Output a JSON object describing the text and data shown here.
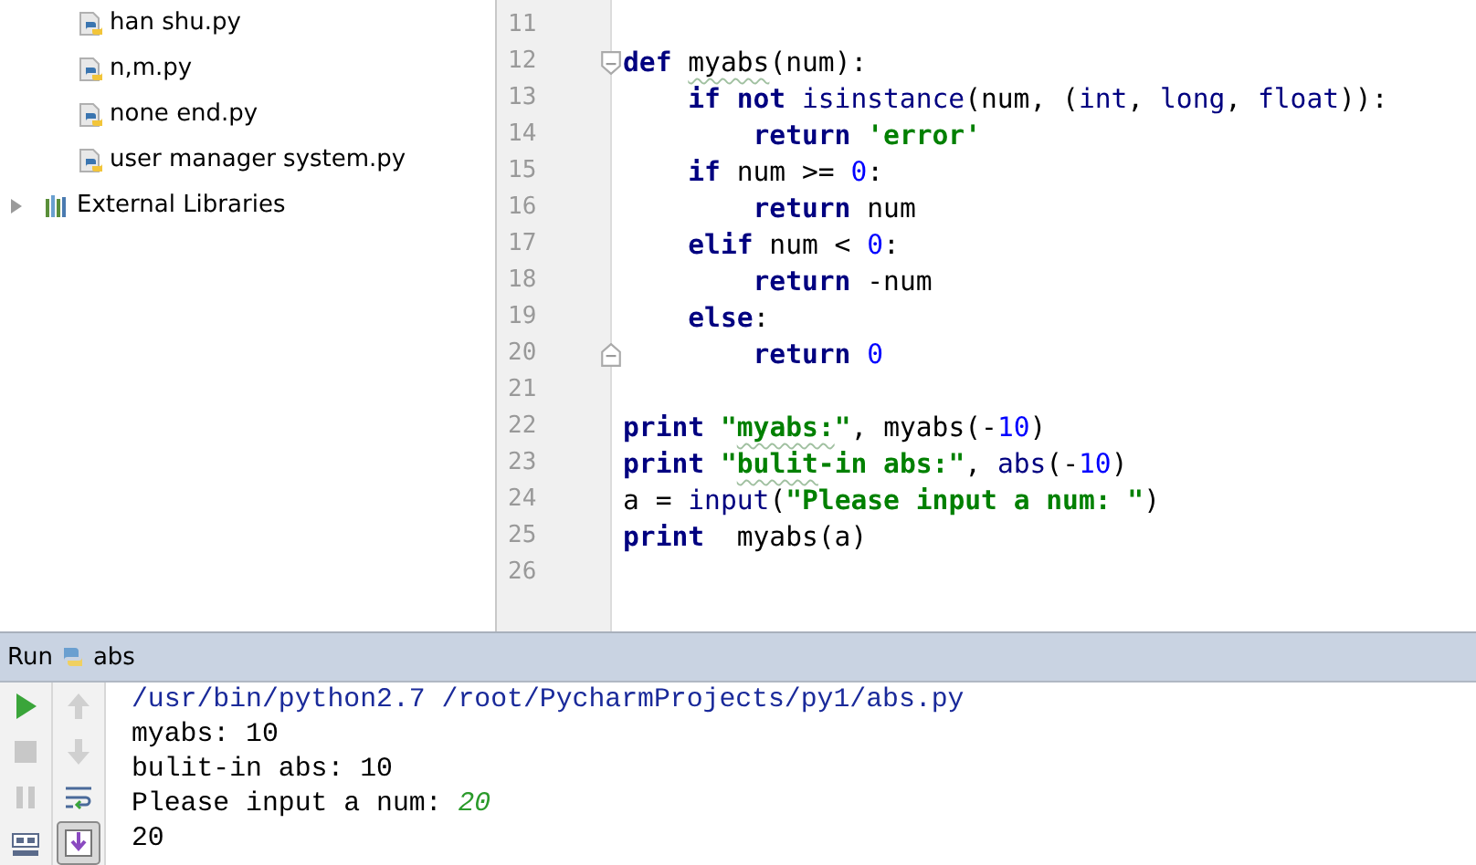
{
  "project_tree": {
    "files": [
      {
        "name": "han shu.py"
      },
      {
        "name": "n,m.py"
      },
      {
        "name": "none end.py"
      },
      {
        "name": "user manager system.py"
      }
    ],
    "libraries": {
      "name": "External Libraries",
      "expanded": false
    }
  },
  "editor": {
    "lines": [
      {
        "number": "11"
      },
      {
        "number": "12",
        "fold_start": true,
        "tokens": [
          {
            "t": "def ",
            "kind": "keyword"
          },
          {
            "t": "myabs",
            "warn": true
          },
          {
            "t": "(num):"
          }
        ],
        "children": [
          {
            "number": "13",
            "tokens": [
              {
                "t": "if not ",
                "kind": "keyword"
              },
              {
                "t": "isinstance",
                "kind": "builtin"
              },
              {
                "t": "(num, ("
              },
              {
                "t": "int",
                "kind": "builtin"
              },
              {
                "t": ", "
              },
              {
                "t": "long",
                "kind": "builtin"
              },
              {
                "t": ", "
              },
              {
                "t": "float",
                "kind": "builtin"
              },
              {
                "t": ")):"
              }
            ],
            "children": [
              {
                "number": "14",
                "tokens": [
                  {
                    "t": "return ",
                    "kind": "keyword"
                  },
                  {
                    "t": "'error'",
                    "kind": "string"
                  }
                ]
              }
            ]
          },
          {
            "number": "15",
            "tokens": [
              {
                "t": "if ",
                "kind": "keyword"
              },
              {
                "t": "num >= "
              },
              {
                "t": "0",
                "kind": "number"
              },
              {
                "t": ":"
              }
            ],
            "children": [
              {
                "number": "16",
                "tokens": [
                  {
                    "t": "return ",
                    "kind": "keyword"
                  },
                  {
                    "t": "num"
                  }
                ]
              }
            ]
          },
          {
            "number": "17",
            "tokens": [
              {
                "t": "elif ",
                "kind": "keyword"
              },
              {
                "t": "num < "
              },
              {
                "t": "0",
                "kind": "number"
              },
              {
                "t": ":"
              }
            ],
            "children": [
              {
                "number": "18",
                "tokens": [
                  {
                    "t": "return ",
                    "kind": "keyword"
                  },
                  {
                    "t": "-num"
                  }
                ]
              }
            ]
          },
          {
            "number": "19",
            "tokens": [
              {
                "t": "else",
                "kind": "keyword"
              },
              {
                "t": ":"
              }
            ],
            "children": [
              {
                "number": "20",
                "fold_end": true,
                "tokens": [
                  {
                    "t": "return ",
                    "kind": "keyword"
                  },
                  {
                    "t": "0",
                    "kind": "number"
                  }
                ]
              }
            ]
          }
        ]
      },
      {
        "number": "21"
      },
      {
        "number": "22",
        "tokens": [
          {
            "t": "print ",
            "kind": "keyword"
          },
          {
            "t": "\"",
            "kind": "string"
          },
          {
            "t": "myabs:",
            "kind": "string",
            "warn": true
          },
          {
            "t": "\"",
            "kind": "string"
          },
          {
            "t": ", myabs(-"
          },
          {
            "t": "10",
            "kind": "number"
          },
          {
            "t": ")"
          }
        ]
      },
      {
        "number": "23",
        "tokens": [
          {
            "t": "print ",
            "kind": "keyword"
          },
          {
            "t": "\"",
            "kind": "string"
          },
          {
            "t": "bulit",
            "kind": "string",
            "warn": true
          },
          {
            "t": "-in abs:\"",
            "kind": "string"
          },
          {
            "t": ", "
          },
          {
            "t": "abs",
            "kind": "builtin"
          },
          {
            "t": "(-"
          },
          {
            "t": "10",
            "kind": "number"
          },
          {
            "t": ")"
          }
        ]
      },
      {
        "number": "24",
        "tokens": [
          {
            "t": "a = "
          },
          {
            "t": "input",
            "kind": "builtin"
          },
          {
            "t": "("
          },
          {
            "t": "\"Please input a num: \"",
            "kind": "string"
          },
          {
            "t": ")"
          }
        ]
      },
      {
        "number": "25",
        "tokens": [
          {
            "t": "print ",
            "kind": "keyword"
          },
          {
            "t": " myabs(a)"
          }
        ]
      },
      {
        "number": "26"
      }
    ]
  },
  "run_panel": {
    "label": "Run",
    "config": "abs",
    "console": [
      {
        "kind": "command",
        "text": "/usr/bin/python2.7 /root/PycharmProjects/py1/abs.py"
      },
      {
        "kind": "output",
        "text": "myabs: 10"
      },
      {
        "kind": "output",
        "text": "bulit-in abs: 10"
      },
      {
        "kind": "output",
        "text": "Please input a num: ",
        "input": "20"
      },
      {
        "kind": "output",
        "text": "20"
      }
    ],
    "scroll_to_end": {
      "on": true
    }
  }
}
